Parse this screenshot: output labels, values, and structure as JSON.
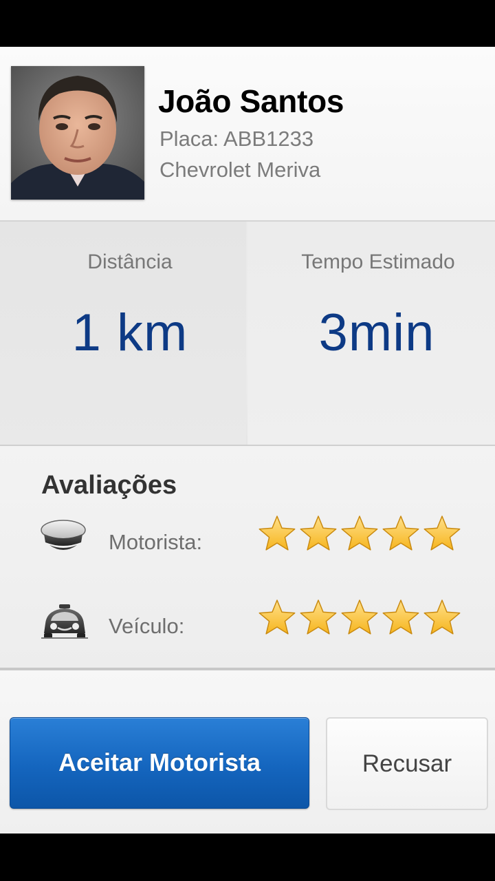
{
  "driver": {
    "name": "João Santos",
    "plate": "Placa: ABB1233",
    "car": "Chevrolet Meriva"
  },
  "stats": {
    "distance_label": "Distância",
    "distance_value": "1 km",
    "time_label": "Tempo Estimado",
    "time_value": "3min"
  },
  "ratings": {
    "title": "Avaliações",
    "driver_label": "Motorista:",
    "driver_stars": 5,
    "vehicle_label": "Veículo:",
    "vehicle_stars": 5,
    "max_stars": 5
  },
  "actions": {
    "accept_label": "Aceitar Motorista",
    "refuse_label": "Recusar"
  },
  "colors": {
    "accent_blue": "#1465be",
    "value_blue": "#0d3a85",
    "star_gold": "#f6b51e"
  },
  "icons": {
    "driver_rating": "chauffeur-cap-icon",
    "vehicle_rating": "taxi-car-icon",
    "star": "star-icon"
  }
}
